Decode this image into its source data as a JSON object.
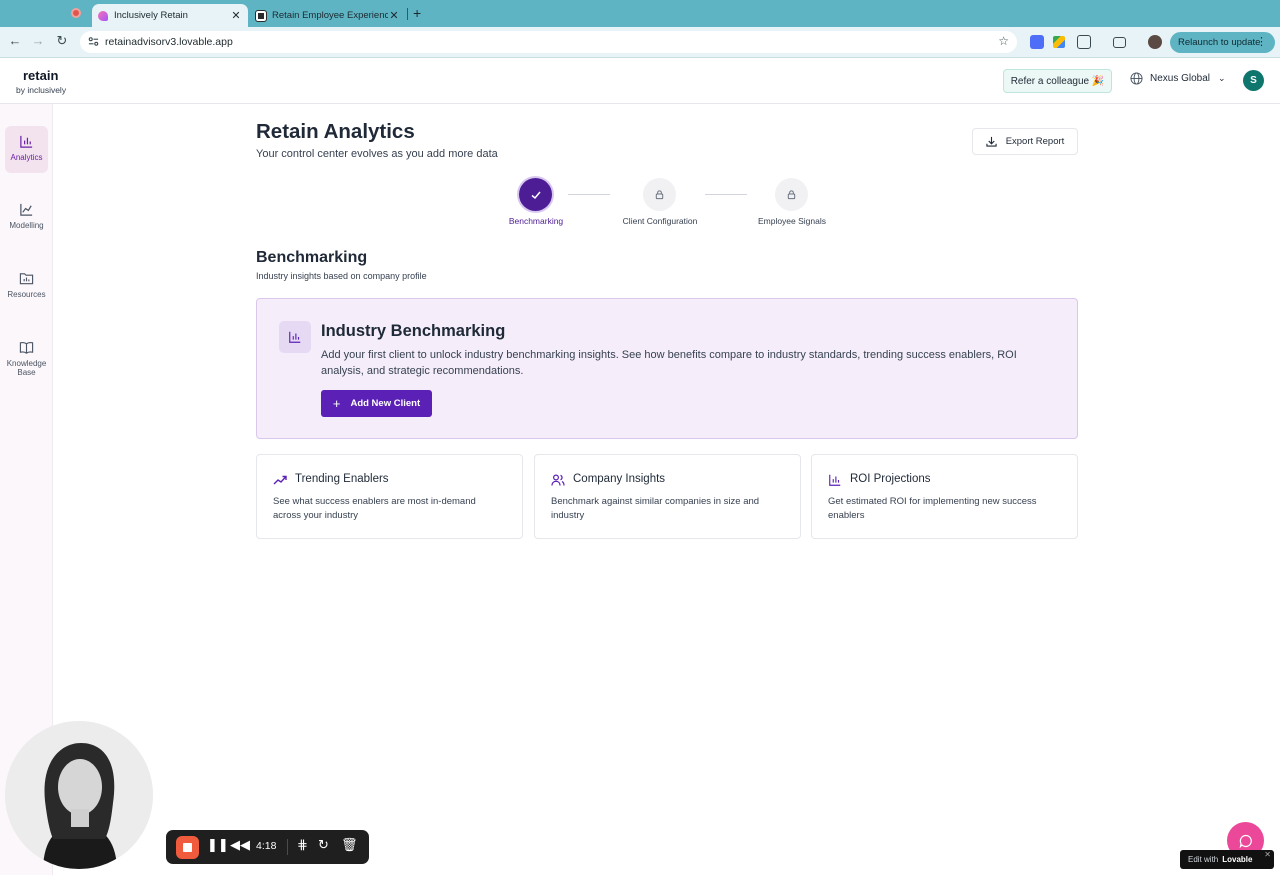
{
  "browser": {
    "tabs": [
      {
        "title": "Inclusively Retain"
      },
      {
        "title": "Retain Employee Experience"
      }
    ],
    "url": "retainadvisorv3.lovable.app",
    "relaunch_label": "Relaunch to update"
  },
  "header": {
    "logo": "retain",
    "logo_sub": "by inclusively",
    "refer_label": "Refer a colleague 🎉",
    "org_name": "Nexus Global",
    "avatar_initial": "S"
  },
  "sidebar": {
    "items": [
      {
        "label": "Analytics",
        "icon": "bar-chart-icon",
        "active": true
      },
      {
        "label": "Modelling",
        "icon": "line-chart-icon"
      },
      {
        "label": "Resources",
        "icon": "folder-chart-icon"
      },
      {
        "label": "Knowledge Base",
        "icon": "book-icon"
      }
    ]
  },
  "main": {
    "title": "Retain Analytics",
    "subtitle": "Your control center evolves as you add more data",
    "export_label": "Export Report",
    "steps": [
      {
        "label": "Benchmarking",
        "state": "complete"
      },
      {
        "label": "Client Configuration",
        "state": "locked"
      },
      {
        "label": "Employee Signals",
        "state": "locked"
      }
    ],
    "section": {
      "title": "Benchmarking",
      "subtitle": "Industry insights based on company profile"
    },
    "hero": {
      "title": "Industry Benchmarking",
      "description": "Add your first client to unlock industry benchmarking insights. See how benefits compare to industry standards, trending success enablers, ROI analysis, and strategic recommendations.",
      "button_label": "Add New Client"
    },
    "features": [
      {
        "title": "Trending Enablers",
        "description": "See what success enablers are most in-demand across your industry",
        "icon": "trending-up-icon"
      },
      {
        "title": "Company Insights",
        "description": "Benchmark against similar companies in size and industry",
        "icon": "users-icon"
      },
      {
        "title": "ROI Projections",
        "description": "Get estimated ROI for implementing new success enablers",
        "icon": "bar-chart-icon"
      }
    ]
  },
  "recorder": {
    "time": "4:18"
  },
  "lovable": {
    "edit_prefix": "Edit with",
    "brand": "Lovable"
  },
  "colors": {
    "accent": "#5b21b6",
    "tabbar": "#5fb4c4",
    "hero_bg": "#f5eefa"
  }
}
